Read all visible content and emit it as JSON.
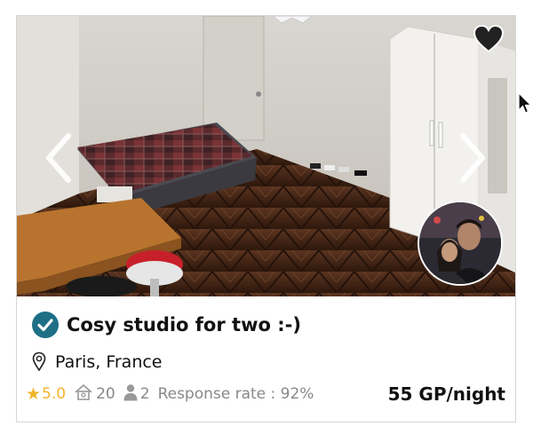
{
  "listing": {
    "title": "Cosy studio for two :-)",
    "location": "Paris, France",
    "rating": "5.0",
    "rating_icon": "star-icon",
    "rooms_count": "20",
    "rooms_icon": "house-icon",
    "guests_count": "2",
    "guests_icon": "person-icon",
    "response_rate": "Response rate : 92%",
    "price": "55 GP/night",
    "verified_icon": "check-badge-icon",
    "favorite_icon": "heart-icon",
    "prev_icon": "chevron-left-icon",
    "next_icon": "chevron-right-icon",
    "location_icon": "map-pin-icon",
    "host_avatar": "host-avatar"
  },
  "colors": {
    "verified_badge": "#1e6f86",
    "rating_star": "#f0b429",
    "muted_text": "#888888",
    "text": "#111111",
    "card_border": "#d6d6d6"
  }
}
